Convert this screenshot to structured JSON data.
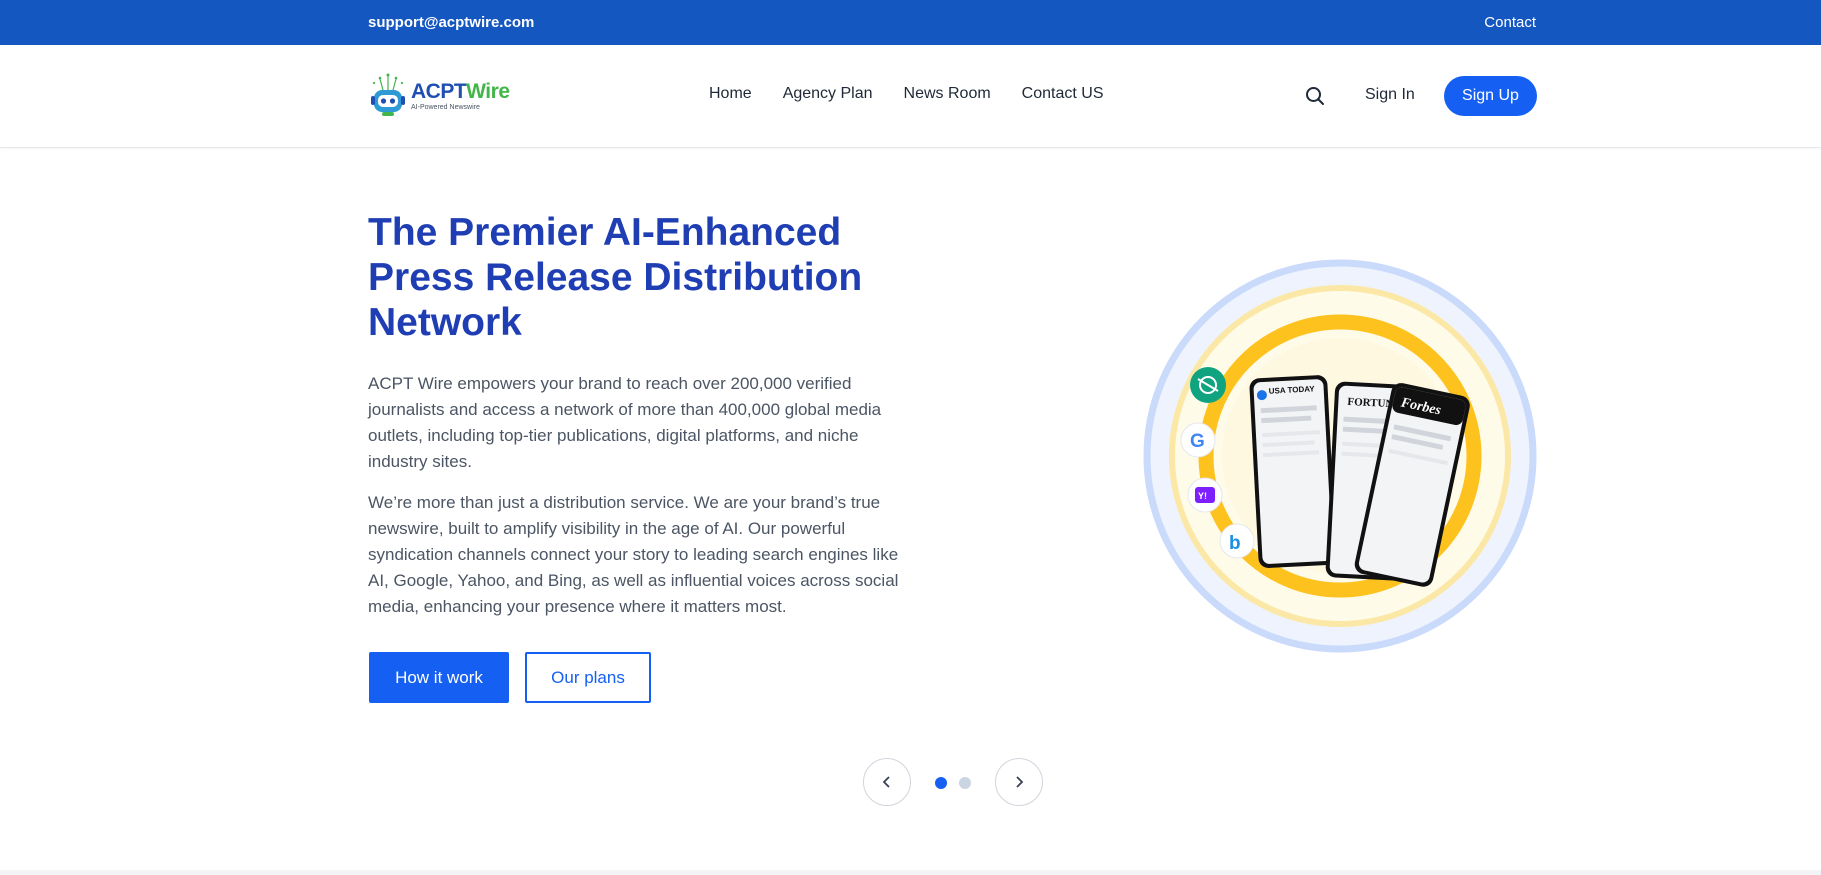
{
  "topbar": {
    "email": "support@acptwire.com",
    "contact": "Contact"
  },
  "brand": {
    "name_part1": "ACPT",
    "name_part2": "Wire",
    "tagline": "AI-Powered Newswire",
    "primary_color": "#1f4fb3",
    "accent_color": "#43b649"
  },
  "nav": {
    "items": [
      {
        "label": "Home"
      },
      {
        "label": "Agency Plan"
      },
      {
        "label": "News Room"
      },
      {
        "label": "Contact US"
      }
    ],
    "search_icon": "search-icon",
    "sign_in": "Sign In",
    "sign_up": "Sign Up"
  },
  "hero": {
    "title": "The Premier AI-Enhanced Press Release Distribution Network",
    "paragraph1": "ACPT Wire empowers your brand to reach over 200,000 verified journalists and access a network of more than 400,000 global media outlets, including top-tier publications, digital platforms, and niche industry sites.",
    "paragraph2": "We’re more than just a distribution service. We are your brand’s true newswire, built to amplify visibility in the age of AI. Our powerful syndication channels connect your story to leading search engines like AI, Google, Yahoo, and Bing, as well as influential voices across social media, enhancing your presence where it matters most.",
    "cta_primary": "How it work",
    "cta_secondary": "Our plans"
  },
  "graphic": {
    "phone_labels": [
      "USA TODAY",
      "FORTUNE",
      "Forbes"
    ],
    "badges": [
      "chatgpt-icon",
      "google-icon",
      "yahoo-icon",
      "bing-icon"
    ],
    "yahoo_text": "Y!"
  },
  "carousel": {
    "active_index": 0,
    "count": 2
  },
  "colors": {
    "topbar": "#1557c0",
    "button": "#1560f2",
    "title": "#1f3eb3"
  }
}
